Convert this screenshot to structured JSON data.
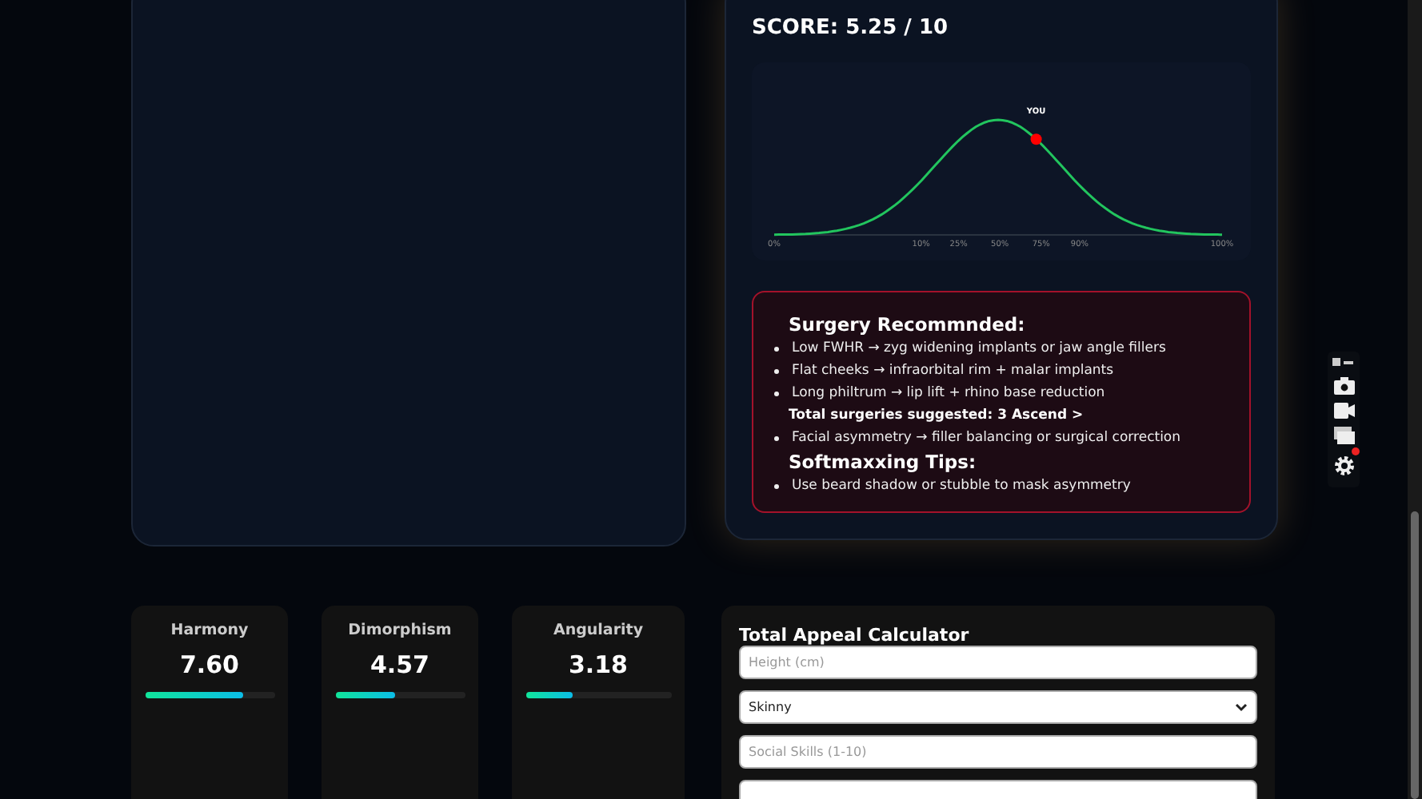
{
  "score": "SCORE: 5.25 / 10",
  "distribution": {
    "marker_label": "YOU",
    "ticks": [
      "0%",
      "10%",
      "25%",
      "50%",
      "75%",
      "90%",
      "100%"
    ]
  },
  "recommendations": [
    {
      "kind": "heading",
      "text": "Surgery Recommnded:"
    },
    {
      "kind": "bullet",
      "text": "Low FWHR → zyg widening implants or jaw angle fillers"
    },
    {
      "kind": "bullet",
      "text": "Flat cheeks → infraorbital rim + malar implants"
    },
    {
      "kind": "bullet",
      "text": "Long philtrum → lip lift + rhino base reduction"
    },
    {
      "kind": "note",
      "text": "Total surgeries suggested: 3 Ascend >"
    },
    {
      "kind": "bullet",
      "text": "Facial asymmetry → filler balancing or surgical correction"
    },
    {
      "kind": "heading",
      "text": "Softmaxxing Tips:"
    },
    {
      "kind": "bullet",
      "text": "Use beard shadow or stubble to mask asymmetry"
    }
  ],
  "metrics": [
    {
      "name": "Harmony",
      "value": "7.60",
      "level": 0.76
    },
    {
      "name": "Dimorphism",
      "value": "4.57",
      "level": 0.46
    },
    {
      "name": "Angularity",
      "value": "3.18",
      "level": 0.32
    }
  ],
  "calculator": {
    "title": "Total Appeal Calculator",
    "fields": [
      {
        "kind": "input",
        "placeholder": "Height (cm)"
      },
      {
        "kind": "select",
        "value": "Skinny"
      },
      {
        "kind": "input",
        "placeholder": "Social Skills (1-10)"
      },
      {
        "kind": "input"
      }
    ]
  },
  "side_toolbar": {
    "notification": true
  }
}
